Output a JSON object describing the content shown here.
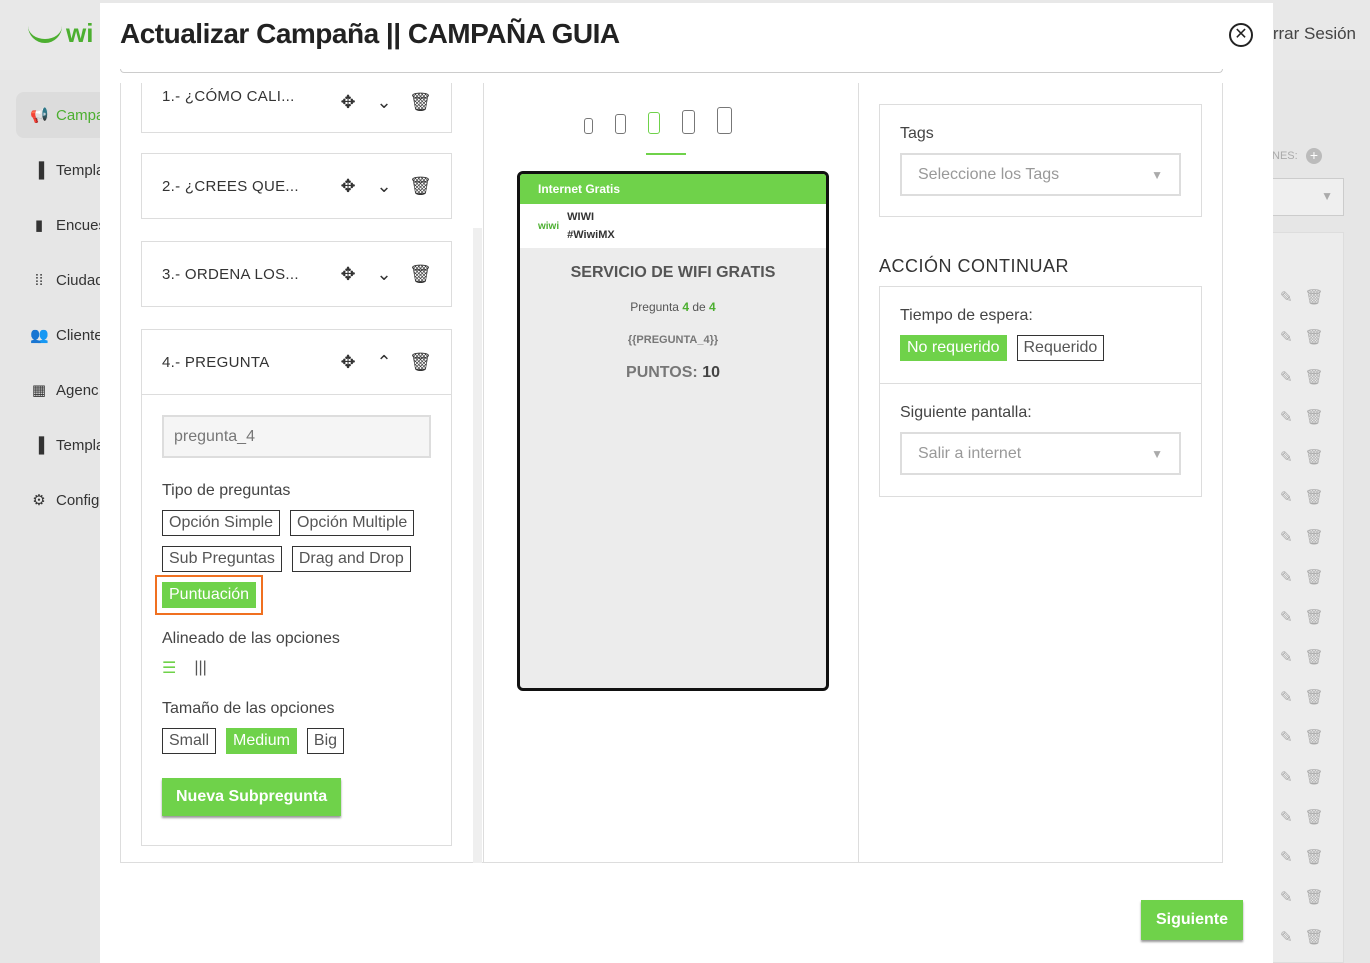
{
  "background": {
    "logo_text": "wi",
    "logout": "rrar Sesión",
    "sidebar": [
      {
        "label": "Campa",
        "icon": "megaphone-icon",
        "glyph": "📢"
      },
      {
        "label": "Templa",
        "icon": "template-icon",
        "glyph": "▐"
      },
      {
        "label": "Encues",
        "icon": "clipboard-icon",
        "glyph": "▮"
      },
      {
        "label": "Ciudad",
        "icon": "grid-dots-icon",
        "glyph": "⁞⁞"
      },
      {
        "label": "Cliente",
        "icon": "users-icon",
        "glyph": "👥"
      },
      {
        "label": "Agenc",
        "icon": "building-icon",
        "glyph": "▦"
      },
      {
        "label": "Templa",
        "icon": "template-icon",
        "glyph": "▐"
      },
      {
        "label": "Config",
        "icon": "gear-icon",
        "glyph": "⚙"
      }
    ],
    "right_header_text": "NES:"
  },
  "modal": {
    "title": "Actualizar Campaña || CAMPAÑA GUIA",
    "questions": [
      {
        "label": "1.- ¿CÓMO CALI..."
      },
      {
        "label": "2.- ¿CREES QUE..."
      },
      {
        "label": "3.- ORDENA LOS..."
      },
      {
        "label": "4.- PREGUNTA"
      }
    ],
    "editor": {
      "input_value": "pregunta_4",
      "type_label": "Tipo de preguntas",
      "types": [
        "Opción Simple",
        "Opción Multiple",
        "Sub Preguntas",
        "Drag and Drop",
        "Puntuación"
      ],
      "selected_type": "Puntuación",
      "align_label": "Alineado de las opciones",
      "size_label": "Tamaño de las opciones",
      "sizes": [
        "Small",
        "Medium",
        "Big"
      ],
      "selected_size": "Medium",
      "new_sub_label": "Nueva Subpregunta"
    },
    "preview": {
      "header": "Internet Gratis",
      "logo_text": "wiwi",
      "brand_name": "WIWI",
      "brand_tag": "#WiwiMX",
      "title": "SERVICIO DE WIFI GRATIS",
      "q_prefix": "Pregunta",
      "q_current": "4",
      "q_mid": "de",
      "q_total": "4",
      "variable": "{{PREGUNTA_4}}",
      "points_label": "PUNTOS:",
      "points_value": "10"
    },
    "right": {
      "tags_label": "Tags",
      "tags_placeholder": "Seleccione los Tags",
      "section_title": "ACCIÓN CONTINUAR",
      "wait_label": "Tiempo de espera:",
      "wait_options": [
        "No requerido",
        "Requerido"
      ],
      "wait_selected": "No requerido",
      "next_screen_label": "Siguiente pantalla:",
      "next_screen_value": "Salir a internet"
    },
    "next_button": "Siguiente"
  },
  "colors": {
    "accent": "#6fd24a",
    "highlight": "#f07020"
  }
}
